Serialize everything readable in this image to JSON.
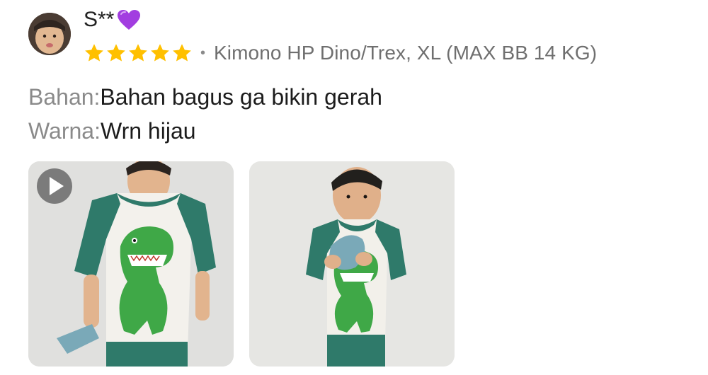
{
  "review": {
    "username": "S**",
    "username_emoji_icon": "purple-heart-icon",
    "rating": 5,
    "rating_max": 5,
    "star_color": "#FFC000",
    "variant": "Kimono HP Dino/Trex, XL (MAX BB 14 KG)",
    "attributes": [
      {
        "key": "Bahan:",
        "value": "Bahan bagus ga bikin gerah"
      },
      {
        "key": "Warna:",
        "value": "Wrn hijau"
      }
    ],
    "media": [
      {
        "type": "video",
        "icon": "play-icon"
      },
      {
        "type": "photo"
      }
    ]
  }
}
